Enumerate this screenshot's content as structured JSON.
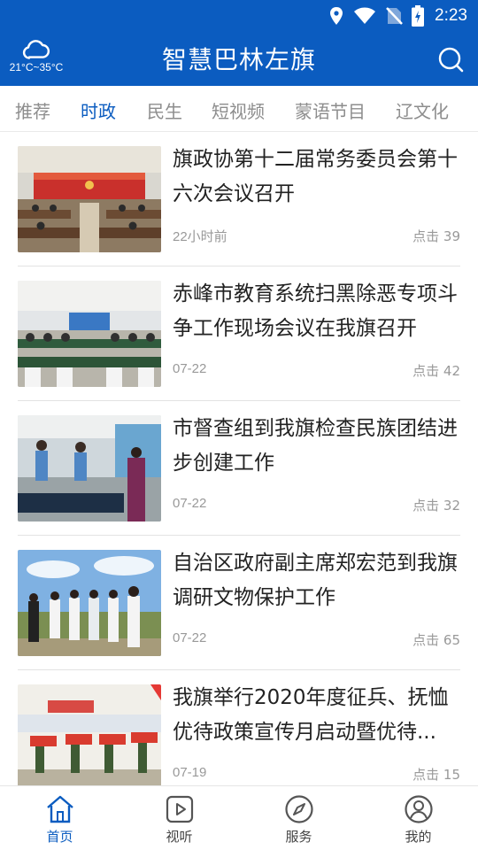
{
  "status_bar": {
    "time": "2:23"
  },
  "header": {
    "weather": {
      "icon": "cloud-icon",
      "temp": "21°C~35°C"
    },
    "title": "智慧巴林左旗",
    "search_icon": "search-icon"
  },
  "tabs": [
    {
      "label": "推荐",
      "active": false
    },
    {
      "label": "时政",
      "active": true
    },
    {
      "label": "民生",
      "active": false
    },
    {
      "label": "短视频",
      "active": false
    },
    {
      "label": "蒙语节目",
      "active": false
    },
    {
      "label": "辽文化",
      "active": false
    }
  ],
  "news": [
    {
      "title": "旗政协第十二届常务委员会第十六次会议召开",
      "time": "22小时前",
      "clicks": "点击 39"
    },
    {
      "title": "赤峰市教育系统扫黑除恶专项斗争工作现场会议在我旗召开",
      "time": "07-22",
      "clicks": "点击 42"
    },
    {
      "title": "市督查组到我旗检查民族团结进步创建工作",
      "time": "07-22",
      "clicks": "点击 32"
    },
    {
      "title": "自治区政府副主席郑宏范到我旗调研文物保护工作",
      "time": "07-22",
      "clicks": "点击 65"
    },
    {
      "title": "我旗举行2020年度征兵、抚恤优待政策宣传月启动暨优待...",
      "time": "07-19",
      "clicks": "点击 15"
    }
  ],
  "bottom_nav": [
    {
      "label": "首页",
      "icon": "home-icon",
      "active": true
    },
    {
      "label": "视听",
      "icon": "play-icon",
      "active": false
    },
    {
      "label": "服务",
      "icon": "compass-icon",
      "active": false
    },
    {
      "label": "我的",
      "icon": "user-icon",
      "active": false
    }
  ],
  "colors": {
    "brand": "#0b5cc0",
    "muted": "#999999"
  }
}
